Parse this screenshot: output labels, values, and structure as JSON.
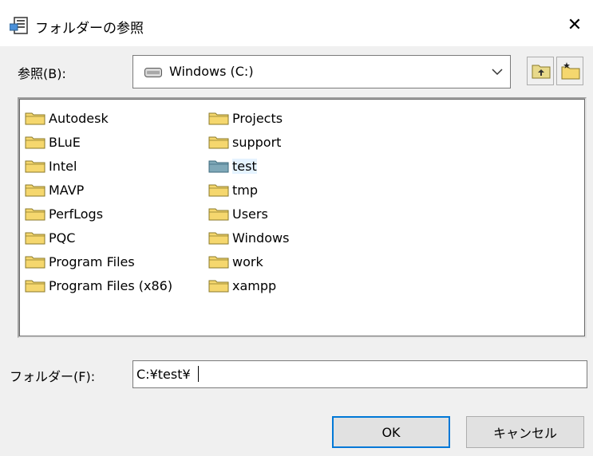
{
  "window": {
    "title": "フォルダーの参照",
    "close_glyph": "✕"
  },
  "lookin": {
    "label": "参照(B):",
    "drive_icon": "drive-icon",
    "selected": "Windows (C:)",
    "dropdown_icon": "chevron-down-icon"
  },
  "toolbar": {
    "up_icon": "up-folder-icon",
    "new_icon": "new-folder-icon"
  },
  "folders": {
    "column1": [
      "Autodesk",
      "BLuE",
      "Intel",
      "MAVP",
      "PerfLogs",
      "PQC",
      "Program Files",
      "Program Files (x86)"
    ],
    "column2": [
      "Projects",
      "support",
      "test",
      "tmp",
      "Users",
      "Windows",
      "work",
      "xampp"
    ],
    "selected": "test"
  },
  "folder_field": {
    "label": "フォルダー(F):",
    "value": "C:¥test¥"
  },
  "buttons": {
    "ok": "OK",
    "cancel": "キャンセル"
  },
  "colors": {
    "focus_border": "#0078d7",
    "folder_yellow": "#f5d76e",
    "folder_selected": "#7fa8b8",
    "hover_bg": "#e5f3ff"
  }
}
